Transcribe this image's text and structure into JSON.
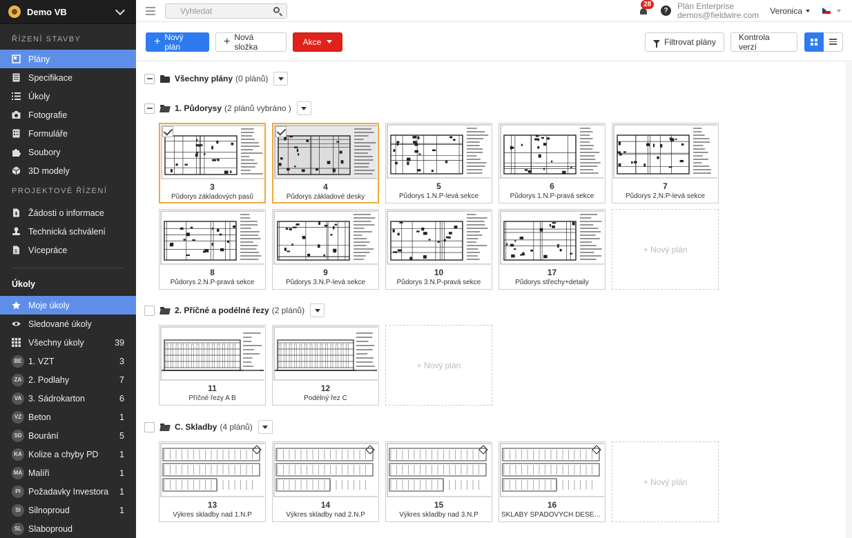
{
  "sidebar": {
    "project_name": "Demo VB",
    "section1": "ŘÍZENÍ STAVBY",
    "nav": [
      {
        "label": "Plány",
        "icon": "plans-icon",
        "active": true
      },
      {
        "label": "Specifikace",
        "icon": "specs-icon"
      },
      {
        "label": "Úkoly",
        "icon": "list-icon"
      },
      {
        "label": "Fotografie",
        "icon": "camera-icon"
      },
      {
        "label": "Formuláře",
        "icon": "forms-icon"
      },
      {
        "label": "Soubory",
        "icon": "puzzle-icon"
      },
      {
        "label": "3D modely",
        "icon": "cube-icon"
      }
    ],
    "section2": "PROJEKTOVÉ ŘÍZENÍ",
    "nav2": [
      {
        "label": "Žádosti o informace",
        "icon": "rfi-icon"
      },
      {
        "label": "Technická schválení",
        "icon": "stamp-icon"
      },
      {
        "label": "Vícepráce",
        "icon": "document-icon"
      }
    ],
    "tasks_title": "Úkoly",
    "tasks": [
      {
        "label": "Moje úkoly",
        "icon": "star-icon",
        "active": true
      },
      {
        "label": "Sledované úkoly",
        "icon": "eye-icon"
      },
      {
        "label": "Všechny úkoly",
        "icon": "grid-icon",
        "count": "39"
      }
    ],
    "teams": [
      {
        "badge": "BE",
        "label": "1. VZT",
        "count": "3"
      },
      {
        "badge": "ZA",
        "label": "2. Podlahy",
        "count": "7"
      },
      {
        "badge": "VA",
        "label": "3. Sádrokarton",
        "count": "6"
      },
      {
        "badge": "VZ",
        "label": "Beton",
        "count": "1"
      },
      {
        "badge": "SD",
        "label": "Bourání",
        "count": "5"
      },
      {
        "badge": "KA",
        "label": "Kolize a chyby PD",
        "count": "1"
      },
      {
        "badge": "MA",
        "label": "Malíři",
        "count": "1"
      },
      {
        "badge": "PI",
        "label": "Požadavky Investora",
        "count": "1"
      },
      {
        "badge": "SI",
        "label": "Silnoproud",
        "count": "1"
      },
      {
        "badge": "SL",
        "label": "Slaboproud",
        "count": ""
      }
    ]
  },
  "topbar": {
    "search_placeholder": "Vyhledat",
    "notifications": "28",
    "help": "?",
    "plan_name": "Plán Enterprise",
    "email": "demos@fieldwire.com",
    "user": "Veronica"
  },
  "toolbar": {
    "new_plan": "Nový plán",
    "new_folder": "Nová složka",
    "actions": "Akce",
    "filter": "Filtrovat plány",
    "version_check": "Kontrola verzí"
  },
  "all_plans": {
    "title": "Všechny plány",
    "subtitle": "(0 plánů)"
  },
  "new_plan_placeholder": "+ Nový plán",
  "groups": [
    {
      "title": "1. Půdorysy",
      "subtitle": "(2 plánů vybráno )",
      "plans": [
        {
          "number": "3",
          "name": "Půdorys základových pasů",
          "selected": true
        },
        {
          "number": "4",
          "name": "Půdorys základové desky",
          "selected": true
        },
        {
          "number": "5",
          "name": "Půdorys 1.N.P-levá sekce"
        },
        {
          "number": "6",
          "name": "Půdorys 1.N.P-pravá sekce"
        },
        {
          "number": "7",
          "name": "Půdorys 2.N.P-levá sekce"
        },
        {
          "number": "8",
          "name": "Půdorys 2.N.P-pravá sekce"
        },
        {
          "number": "9",
          "name": "Půdorys 3.N.P-levá sekce"
        },
        {
          "number": "10",
          "name": "Půdorys 3.N.P-pravá sekce"
        },
        {
          "number": "17",
          "name": "Půdorys střechy+detaily"
        }
      ]
    },
    {
      "title": "2. Příčné a podélné řezy",
      "subtitle": "(2 plánů)",
      "plans": [
        {
          "number": "11",
          "name": "Příčné řezy A B"
        },
        {
          "number": "12",
          "name": "Podélný řez C"
        }
      ]
    },
    {
      "title": "C. Skladby",
      "subtitle": "(4 plánů)",
      "plans": [
        {
          "number": "13",
          "name": "Výkres skladby nad 1.N.P"
        },
        {
          "number": "14",
          "name": "Výkres skladby nad 2.N.P"
        },
        {
          "number": "15",
          "name": "Výkres skladby nad 3.N.P"
        },
        {
          "number": "16",
          "name": "SKLABY SPÁDOVÝCH DESEK…"
        }
      ]
    }
  ],
  "colors": {
    "accent": "#2e7bf0",
    "active_nav": "#5f8ee8",
    "danger": "#e0221b",
    "selected": "#f0a83a",
    "sidebar": "#2b2b2b"
  }
}
